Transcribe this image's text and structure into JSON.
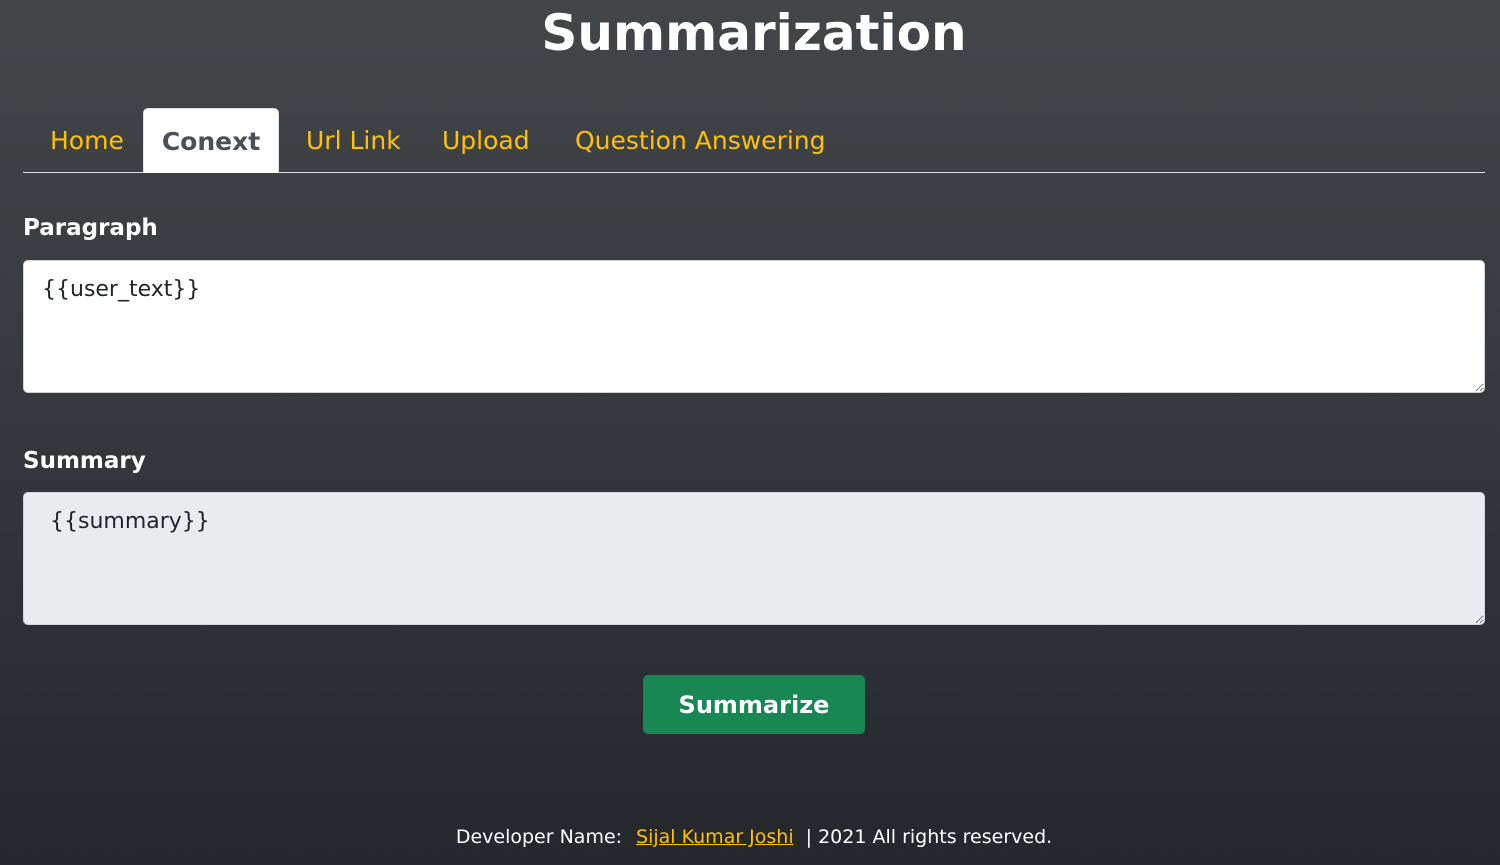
{
  "header": {
    "title": "Summarization"
  },
  "tabs": [
    {
      "label": "Home",
      "active": false
    },
    {
      "label": "Conext",
      "active": true
    },
    {
      "label": "Url Link",
      "active": false
    },
    {
      "label": "Upload",
      "active": false
    },
    {
      "label": "Question Answering",
      "active": false
    }
  ],
  "form": {
    "paragraph_label": "Paragraph",
    "paragraph_value": "{{user_text}}",
    "summary_label": "Summary",
    "summary_value": "{{summary}}",
    "submit_label": "Summarize"
  },
  "footer": {
    "prefix": "Developer Name:",
    "developer_name": "Sijal Kumar Joshi",
    "suffix": "| 2021 All rights reserved."
  },
  "colors": {
    "accent": "#ffc107",
    "button": "#198754",
    "active_tab_text": "#495057",
    "summary_background": "#e9ecef"
  }
}
